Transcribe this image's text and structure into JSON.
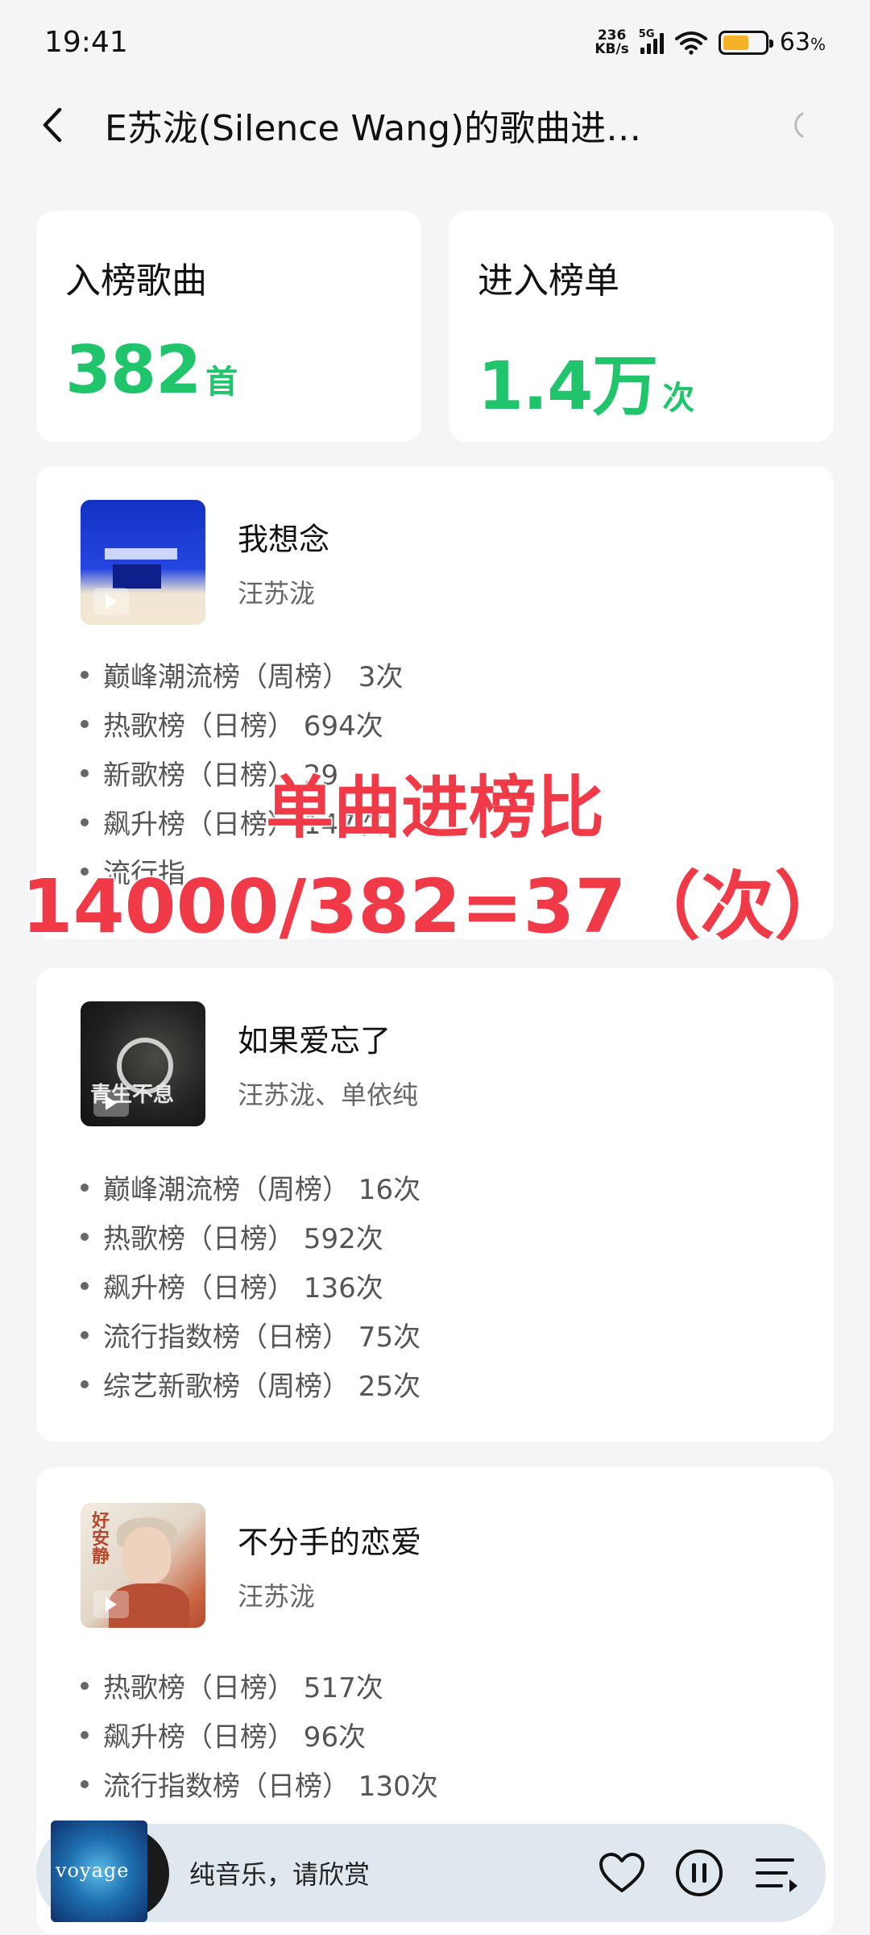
{
  "status_bar": {
    "time": "19:41",
    "net_speed_value": "236",
    "net_speed_unit": "KB/s",
    "network": "5G",
    "battery_percent": "63",
    "battery_unit": "%",
    "battery_level": 0.63
  },
  "header": {
    "title": "E苏泷(Silence Wang)的歌曲进…"
  },
  "stats": {
    "songs_label": "入榜歌曲",
    "songs_value": "382",
    "songs_unit": "首",
    "entries_label": "进入榜单",
    "entries_value": "1.4万",
    "entries_unit": "次",
    "accent_color": "#1fc46b"
  },
  "songs": [
    {
      "title": "我想念",
      "artist": "汪苏泷",
      "charts": [
        "巅峰潮流榜（周榜） 3次",
        "热歌榜（日榜） 694次",
        "新歌榜（日榜） 29",
        "飙升榜（日榜） 147次",
        "流行指"
      ]
    },
    {
      "title": "如果爱忘了",
      "artist": "汪苏泷、单依纯",
      "cover_text": "青生不息",
      "charts": [
        "巅峰潮流榜（周榜） 16次",
        "热歌榜（日榜） 592次",
        "飙升榜（日榜） 136次",
        "流行指数榜（日榜） 75次",
        "综艺新歌榜（周榜） 25次"
      ]
    },
    {
      "title": "不分手的恋爱",
      "artist": "汪苏泷",
      "cover_text": "好安静",
      "charts": [
        "热歌榜（日榜） 517次",
        "飙升榜（日榜） 96次",
        "流行指数榜（日榜） 130次"
      ]
    }
  ],
  "overlay": {
    "line1": "单曲进榜比",
    "line2": "14000/382=37（次）",
    "color": "#f03a48"
  },
  "player": {
    "cover_text": "voyage",
    "now_playing": "纯音乐，请欣赏"
  }
}
